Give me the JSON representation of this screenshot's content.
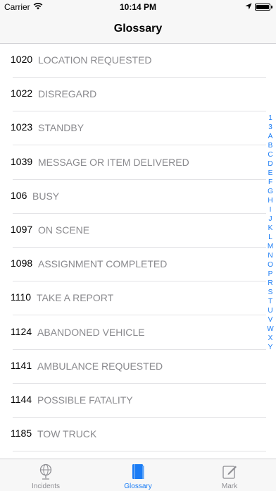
{
  "status_bar": {
    "carrier": "Carrier",
    "time": "10:14 PM"
  },
  "nav": {
    "title": "Glossary"
  },
  "glossary": [
    {
      "code": "1020",
      "desc": "LOCATION REQUESTED"
    },
    {
      "code": "1022",
      "desc": "DISREGARD"
    },
    {
      "code": "1023",
      "desc": "STANDBY"
    },
    {
      "code": "1039",
      "desc": "MESSAGE OR ITEM DELIVERED"
    },
    {
      "code": "106",
      "desc": "BUSY"
    },
    {
      "code": "1097",
      "desc": "ON SCENE"
    },
    {
      "code": "1098",
      "desc": "ASSIGNMENT COMPLETED"
    },
    {
      "code": "1110",
      "desc": "TAKE A REPORT"
    },
    {
      "code": "1124",
      "desc": "ABANDONED VEHICLE"
    },
    {
      "code": "1141",
      "desc": "AMBULANCE REQUESTED"
    },
    {
      "code": "1144",
      "desc": "POSSIBLE FATALITY"
    },
    {
      "code": "1185",
      "desc": "TOW TRUCK"
    }
  ],
  "index_letters": [
    "1",
    "3",
    "A",
    "B",
    "C",
    "D",
    "E",
    "F",
    "G",
    "H",
    "I",
    "J",
    "K",
    "L",
    "M",
    "N",
    "O",
    "P",
    "R",
    "S",
    "T",
    "U",
    "V",
    "W",
    "X",
    "Y"
  ],
  "tabs": [
    {
      "label": "Incidents",
      "icon": "globe-icon",
      "active": false
    },
    {
      "label": "Glossary",
      "icon": "book-icon",
      "active": true
    },
    {
      "label": "Mark",
      "icon": "compose-icon",
      "active": false
    }
  ],
  "colors": {
    "accent": "#1a7cf5",
    "secondary_text": "#8a8a8e",
    "bar_background": "#f7f7f7"
  }
}
